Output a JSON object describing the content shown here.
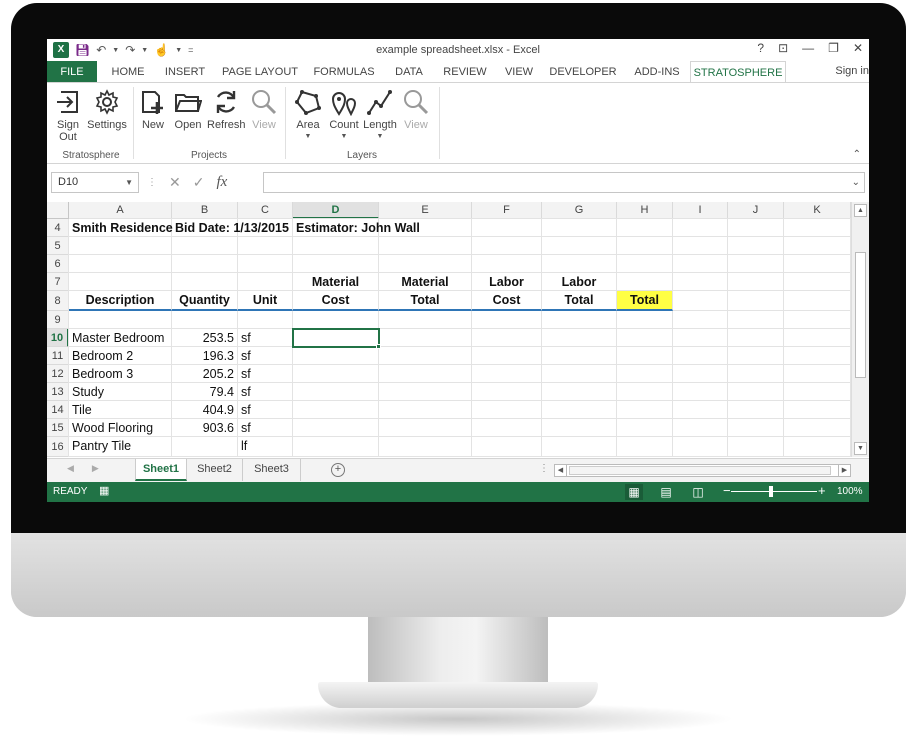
{
  "window": {
    "title": "example spreadsheet.xlsx - Excel",
    "controls": [
      "?",
      "⊡",
      "—",
      "❐",
      "✕"
    ]
  },
  "quick_access": {
    "logo": "X",
    "save_icon": "save-icon",
    "undo_icon": "undo-icon",
    "redo_icon": "redo-icon",
    "touch_icon": "touch-icon",
    "customize": "="
  },
  "tabs": [
    "FILE",
    "HOME",
    "INSERT",
    "PAGE LAYOUT",
    "FORMULAS",
    "DATA",
    "REVIEW",
    "VIEW",
    "DEVELOPER",
    "ADD-INS",
    "STRATOSPHERE"
  ],
  "active_tab": "STRATOSPHERE",
  "sign_in": "Sign in",
  "ribbon": {
    "groups": [
      {
        "label": "Stratosphere",
        "buttons": [
          {
            "label": "Sign\nOut",
            "icon": "sign-out-icon"
          },
          {
            "label": "Settings",
            "icon": "gear-icon"
          }
        ]
      },
      {
        "label": "Projects",
        "buttons": [
          {
            "label": "New",
            "icon": "new-icon"
          },
          {
            "label": "Open",
            "icon": "folder-icon"
          },
          {
            "label": "Refresh",
            "icon": "refresh-icon"
          },
          {
            "label": "View",
            "icon": "magnifier-icon",
            "disabled": true
          }
        ]
      },
      {
        "label": "Layers",
        "buttons": [
          {
            "label": "Area",
            "icon": "area-icon",
            "dropdown": true
          },
          {
            "label": "Count",
            "icon": "count-icon",
            "dropdown": true
          },
          {
            "label": "Length",
            "icon": "length-icon",
            "dropdown": true
          },
          {
            "label": "View",
            "icon": "magnifier-icon",
            "disabled": true
          }
        ]
      }
    ]
  },
  "formula_bar": {
    "name_box": "D10",
    "formula": ""
  },
  "columns": [
    "A",
    "B",
    "C",
    "D",
    "E",
    "F",
    "G",
    "H",
    "I",
    "J",
    "K"
  ],
  "selected_column": "D",
  "rows": [
    "4",
    "5",
    "6",
    "7",
    "8",
    "9",
    "10",
    "11",
    "12",
    "13",
    "14",
    "15",
    "16"
  ],
  "selected_row": "10",
  "sheet": {
    "r4": {
      "A": "Smith Residence",
      "B": "Bid Date: 1/13/2015",
      "D": "Estimator: John Wall"
    },
    "r7": {
      "D": "Material",
      "E": "Material",
      "F": "Labor",
      "G": "Labor"
    },
    "r8": {
      "A": "Description",
      "B": "Quantity",
      "C": "Unit",
      "D": "Cost",
      "E": "Total",
      "F": "Cost",
      "G": "Total",
      "H": "Total"
    },
    "items": [
      {
        "desc": "Master Bedroom",
        "qty": "253.5",
        "unit": "sf"
      },
      {
        "desc": "Bedroom 2",
        "qty": "196.3",
        "unit": "sf"
      },
      {
        "desc": "Bedroom 3",
        "qty": "205.2",
        "unit": "sf"
      },
      {
        "desc": "Study",
        "qty": "79.4",
        "unit": "sf"
      },
      {
        "desc": "Tile",
        "qty": "404.9",
        "unit": "sf"
      },
      {
        "desc": "Wood Flooring",
        "qty": "903.6",
        "unit": "sf"
      },
      {
        "desc": "Pantry Tile",
        "qty": "",
        "unit": "lf"
      }
    ]
  },
  "sheet_tabs": [
    "Sheet1",
    "Sheet2",
    "Sheet3"
  ],
  "active_sheet": "Sheet1",
  "status": {
    "ready": "READY",
    "zoom": "100%"
  },
  "colors": {
    "excel_green": "#217346",
    "highlight": "#ffff44",
    "header_rule": "#2e75b6"
  }
}
